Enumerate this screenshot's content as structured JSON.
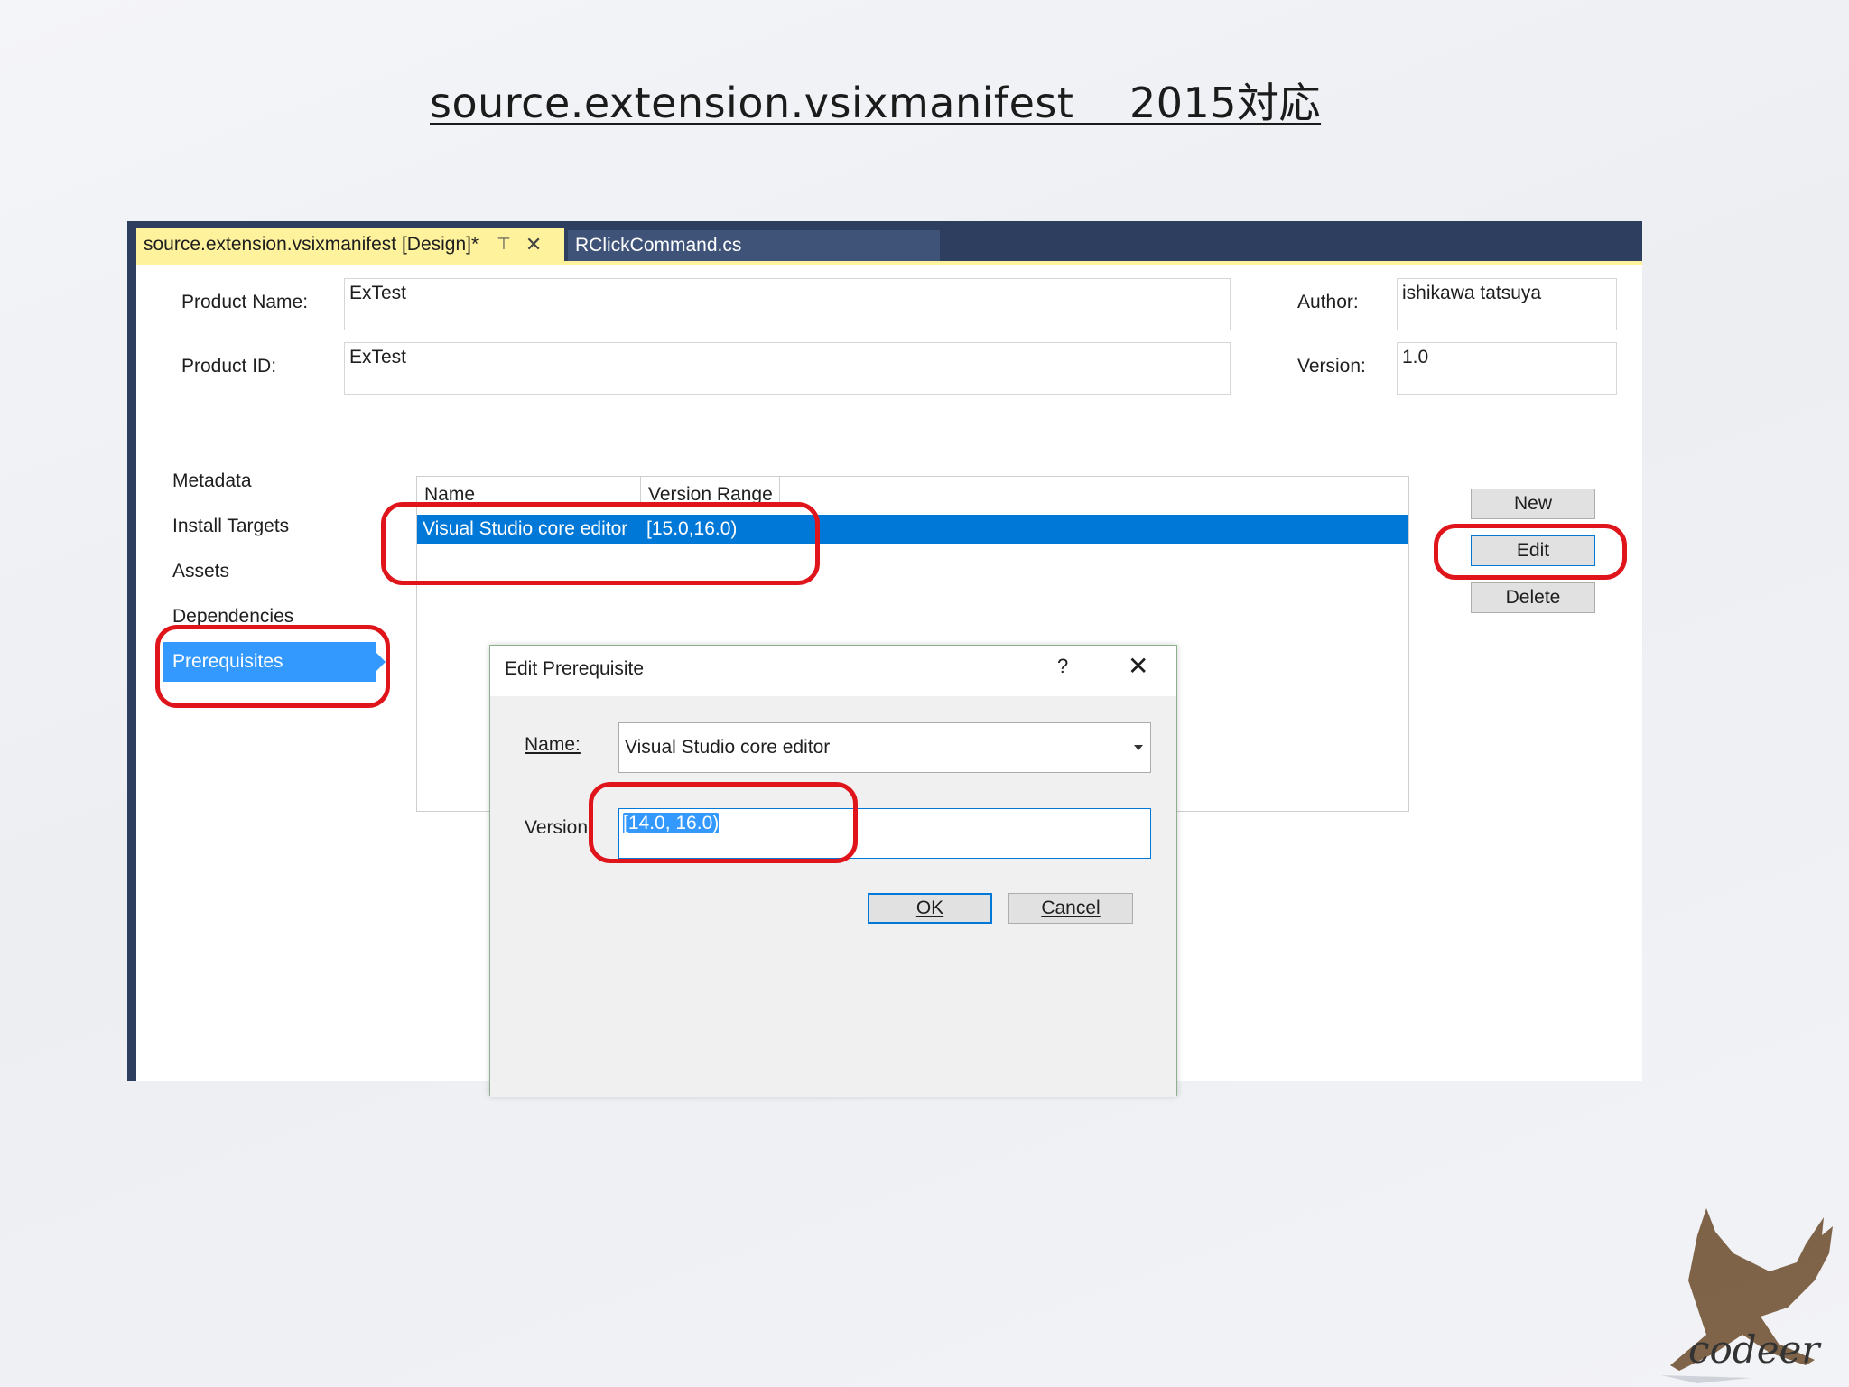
{
  "slide": {
    "title": "source.extension.vsixmanifest　 2015対応"
  },
  "tabs": {
    "active_label": "source.extension.vsixmanifest [Design]*",
    "pin_glyph": "⊤",
    "close_glyph": "✕",
    "inactive_label": "RClickCommand.cs"
  },
  "form": {
    "product_name_label": "Product Name:",
    "product_name_value": "ExTest",
    "product_id_label": "Product ID:",
    "product_id_value": "ExTest",
    "author_label": "Author:",
    "author_value": "ishikawa tatsuya",
    "version_label": "Version:",
    "version_value": "1.0"
  },
  "nav": {
    "items": [
      "Metadata",
      "Install Targets",
      "Assets",
      "Dependencies"
    ],
    "active": "Prerequisites"
  },
  "grid": {
    "columns": [
      "Name",
      "Version Range"
    ],
    "rows": [
      {
        "name": "Visual Studio core editor",
        "version_range": "[15.0,16.0)"
      }
    ]
  },
  "actions": {
    "new": "New",
    "edit": "Edit",
    "delete": "Delete"
  },
  "dialog": {
    "title": "Edit Prerequisite",
    "help": "?",
    "close": "✕",
    "name_label": "Name:",
    "name_value": "Visual Studio core editor",
    "version_label": "Version:",
    "version_value": "[14.0, 16.0)",
    "ok": "OK",
    "cancel": "Cancel"
  },
  "branding": {
    "logo_text": "codeer"
  },
  "colors": {
    "highlight_circle": "#e0151c",
    "selection": "#0078d7",
    "active_tab": "#fff29d",
    "ide_frame": "#2d3e5f"
  }
}
